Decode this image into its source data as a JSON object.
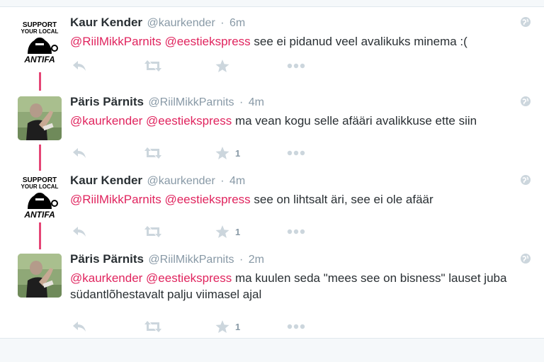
{
  "tweets": [
    {
      "fullname": "Kaur Kender",
      "username": "@kaurkender",
      "time": "6m",
      "avatar": "support-your-local-avatar",
      "mentions": [
        "@RiilMikkParnits",
        "@eestiekspress"
      ],
      "text": " see ei pidanud veel avalikuks minema :(",
      "favorite_count": ""
    },
    {
      "fullname": "Päris Pärnits",
      "username": "@RiilMikkParnits",
      "time": "4m",
      "avatar": "photo-avatar",
      "mentions": [
        "@kaurkender",
        "@eestiekspress"
      ],
      "text": " ma vean kogu selle afääri avalikkuse ette siin",
      "favorite_count": "1"
    },
    {
      "fullname": "Kaur Kender",
      "username": "@kaurkender",
      "time": "4m",
      "avatar": "support-your-local-avatar",
      "mentions": [
        "@RiilMikkParnits",
        "@eestiekspress"
      ],
      "text": " see on lihtsalt äri, see ei ole afäär",
      "favorite_count": "1"
    },
    {
      "fullname": "Päris Pärnits",
      "username": "@RiilMikkParnits",
      "time": "2m",
      "avatar": "photo-avatar",
      "mentions": [
        "@kaurkender",
        "@eestiekspress"
      ],
      "text": " ma kuulen seda \"mees see on bisness\" lauset juba südantlõhestavalt palju viimasel ajal",
      "favorite_count": "1"
    }
  ],
  "avatar_lettering": {
    "top": "SUPPORT",
    "middle": "YOUR LOCAL",
    "bottom": "ANTIFA"
  },
  "separator": "·",
  "colors": {
    "mention": "#e0245e",
    "meta": "#8899a6",
    "action_icon": "#ccd6dd",
    "thread_line": "#e0245e"
  },
  "icons": [
    "reply-icon",
    "retweet-icon",
    "favorite-star-icon",
    "more-dots-icon",
    "globe-icon"
  ]
}
